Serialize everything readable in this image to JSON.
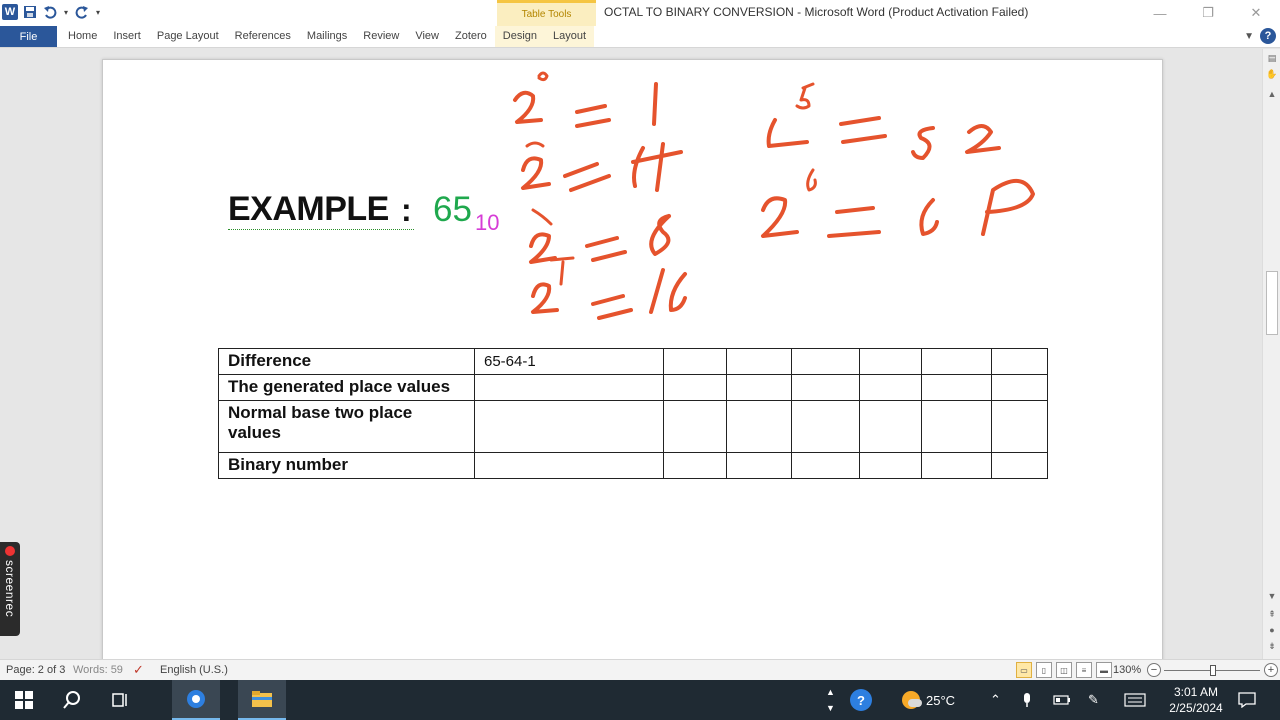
{
  "titlebar": {
    "app_icon": "W",
    "save_icon": "save-icon",
    "undo_icon": "undo-icon",
    "redo_icon": "redo-icon",
    "contextual_group": "Table Tools",
    "title": "OCTAL TO BINARY CONVERSION  -  Microsoft Word (Product Activation Failed)"
  },
  "ribbon": {
    "file_tab": "File",
    "tabs": [
      "Home",
      "Insert",
      "Page Layout",
      "References",
      "Mailings",
      "Review",
      "View",
      "Zotero",
      "Design",
      "Layout"
    ]
  },
  "document": {
    "heading": "EXAMPLE",
    "colon": ":",
    "number": "65",
    "base": "10",
    "table": {
      "rows": [
        {
          "label": "Difference",
          "value": "65-64-1"
        },
        {
          "label": "The generated place values",
          "value": ""
        },
        {
          "label": "Normal base two place values",
          "value": ""
        },
        {
          "label": "Binary number",
          "value": ""
        }
      ]
    },
    "ink_color": "#e5532d"
  },
  "screenrec": {
    "label": "screenrec"
  },
  "statusbar": {
    "page": "Page: 2 of 3",
    "words": "Words: 59",
    "language": "English (U.S.)",
    "zoom": "130%",
    "zoom_minus": "−",
    "zoom_plus": "+"
  },
  "taskbar": {
    "temperature": "25°C",
    "time": "3:01 AM",
    "date": "2/25/2024"
  }
}
